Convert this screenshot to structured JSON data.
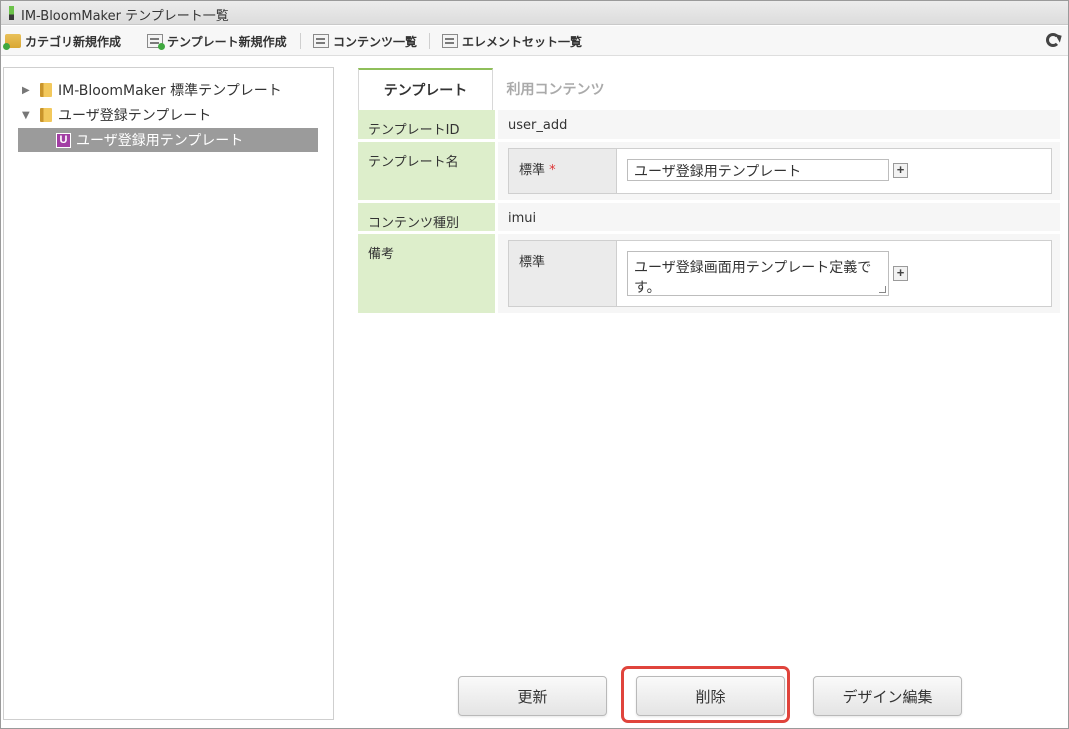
{
  "window": {
    "title": "IM-BloomMaker テンプレート一覧"
  },
  "toolbar": {
    "new_category": "カテゴリ新規作成",
    "new_template": "テンプレート新規作成",
    "content_list": "コンテンツ一覧",
    "elementset_list": "エレメントセット一覧"
  },
  "tree": {
    "items": [
      {
        "label": "IM-BloomMaker 標準テンプレート",
        "arrow": "▶"
      },
      {
        "label": "ユーザ登録テンプレート",
        "arrow": "▼"
      },
      {
        "label": "ユーザ登録用テンプレート",
        "badge": "U"
      }
    ]
  },
  "tabs": {
    "template": "テンプレート",
    "used_contents": "利用コンテンツ"
  },
  "form": {
    "template_id": {
      "label": "テンプレートID",
      "value": "user_add"
    },
    "template_name": {
      "label": "テンプレート名",
      "locale_label": "標準",
      "required_mark": "*",
      "value": "ユーザ登録用テンプレート"
    },
    "content_type": {
      "label": "コンテンツ種別",
      "value": "imui"
    },
    "remarks": {
      "label": "備考",
      "locale_label": "標準",
      "value": "ユーザ登録画面用テンプレート定義です。"
    },
    "plus": "+"
  },
  "buttons": {
    "update": "更新",
    "delete": "削除",
    "design_edit": "デザイン編集"
  }
}
